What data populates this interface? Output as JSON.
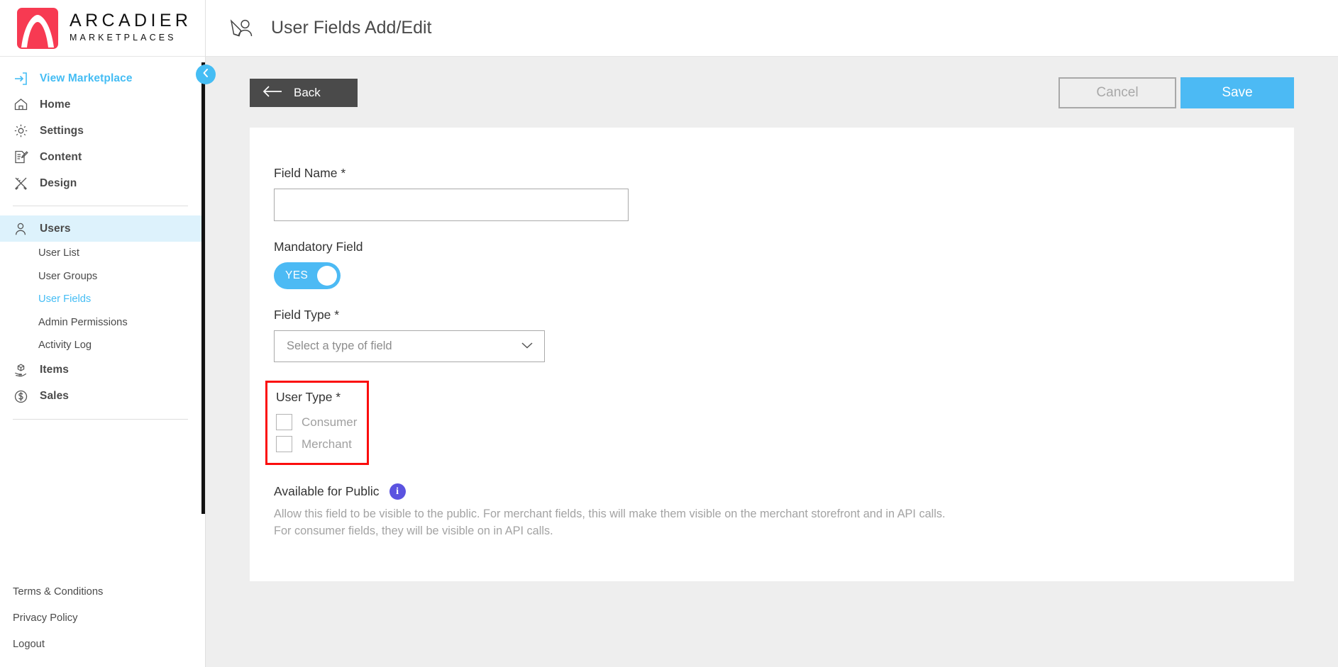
{
  "brand": {
    "name_line1": "ARCADIER",
    "name_line2": "MARKETPLACES",
    "logo_color": "#f73a52",
    "accent_color": "#45bdf4"
  },
  "sidebar": {
    "view_marketplace": {
      "label": "View Marketplace",
      "icon": "export-icon"
    },
    "items": [
      {
        "label": "Home",
        "icon": "home-icon"
      },
      {
        "label": "Settings",
        "icon": "gear-icon"
      },
      {
        "label": "Content",
        "icon": "document-pencil-icon"
      },
      {
        "label": "Design",
        "icon": "ruler-pencil-icon"
      }
    ],
    "users_section": {
      "label": "Users",
      "icon": "user-icon",
      "active": true,
      "sub_items": [
        {
          "label": "User List",
          "active": false
        },
        {
          "label": "User Groups",
          "active": false
        },
        {
          "label": "User Fields",
          "active": true
        },
        {
          "label": "Admin Permissions",
          "active": false
        },
        {
          "label": "Activity Log",
          "active": false
        }
      ]
    },
    "lower_items": [
      {
        "label": "Items",
        "icon": "box-hand-icon"
      },
      {
        "label": "Sales",
        "icon": "dollar-circle-icon"
      }
    ],
    "footer_links": [
      {
        "label": "Terms & Conditions"
      },
      {
        "label": "Privacy Policy"
      },
      {
        "label": "Logout"
      }
    ],
    "collapse_button": {
      "icon": "chevron-left-icon"
    }
  },
  "header": {
    "title": "User Fields Add/Edit",
    "icon": "user-edit-icon"
  },
  "toolbar": {
    "back_label": "Back",
    "cancel_label": "Cancel",
    "save_label": "Save"
  },
  "form": {
    "field_name": {
      "label": "Field Name *",
      "value": "",
      "placeholder": ""
    },
    "mandatory_field": {
      "label": "Mandatory Field",
      "toggle_value": "YES",
      "enabled": true
    },
    "field_type": {
      "label": "Field Type *",
      "selected": "Select a type of field"
    },
    "user_type": {
      "label": "User Type *",
      "highlighted": true,
      "highlight_color": "#fb0d0d",
      "options": [
        {
          "label": "Consumer",
          "checked": false
        },
        {
          "label": "Merchant",
          "checked": false
        }
      ]
    },
    "available_for_public": {
      "label": "Available for Public",
      "info_icon": "info-icon",
      "description_line1": "Allow this field to be visible to the public. For merchant fields, this will make them visible on the merchant storefront and in API calls.",
      "description_line2": "For consumer fields, they will be visible on in API calls."
    }
  }
}
